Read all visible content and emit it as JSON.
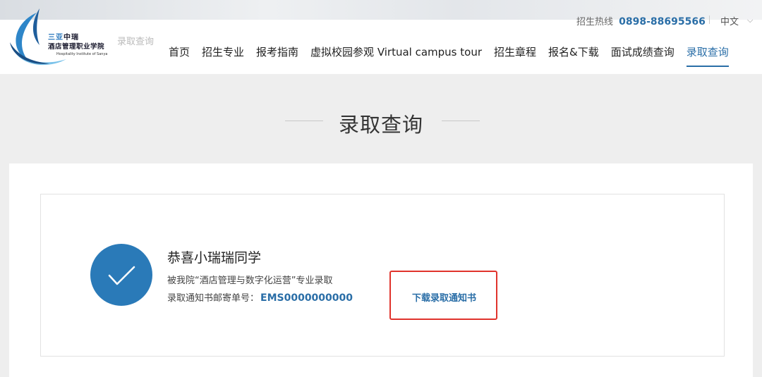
{
  "header": {
    "logo": {
      "name_line1_prefix": "三亚",
      "name_line1_suffix": "中瑞",
      "name_line2": "酒店管理职业学院",
      "name_en": "Hospitality Institute of Sanya",
      "icon": "school-logo-icon"
    },
    "ghost_breadcrumb": "录取查询",
    "hotline_label": "招生热线",
    "hotline_number": "0898-88695566",
    "language": "中文",
    "language_icon": "chevron-down-icon",
    "nav": [
      {
        "label": "首页"
      },
      {
        "label": "招生专业"
      },
      {
        "label": "报考指南"
      },
      {
        "label": "虚拟校园参观 Virtual campus tour"
      },
      {
        "label": "招生章程"
      },
      {
        "label": "报名&下载"
      },
      {
        "label": "面试成绩查询"
      },
      {
        "label": "录取查询",
        "active": true
      }
    ]
  },
  "page": {
    "title": "录取查询"
  },
  "result": {
    "icon": "checkmark-icon",
    "congrats": "恭喜小瑞瑞同学",
    "admission_text": "被我院“酒店管理与数字化运营”专业录取",
    "mail_label": "录取通知书邮寄单号：",
    "mail_number": "EMS0000000000",
    "download_label": "下载录取通知书"
  },
  "colors": {
    "accent": "#2a6ea7",
    "check_circle": "#2a7ab8",
    "highlight_box": "#e0332c"
  }
}
